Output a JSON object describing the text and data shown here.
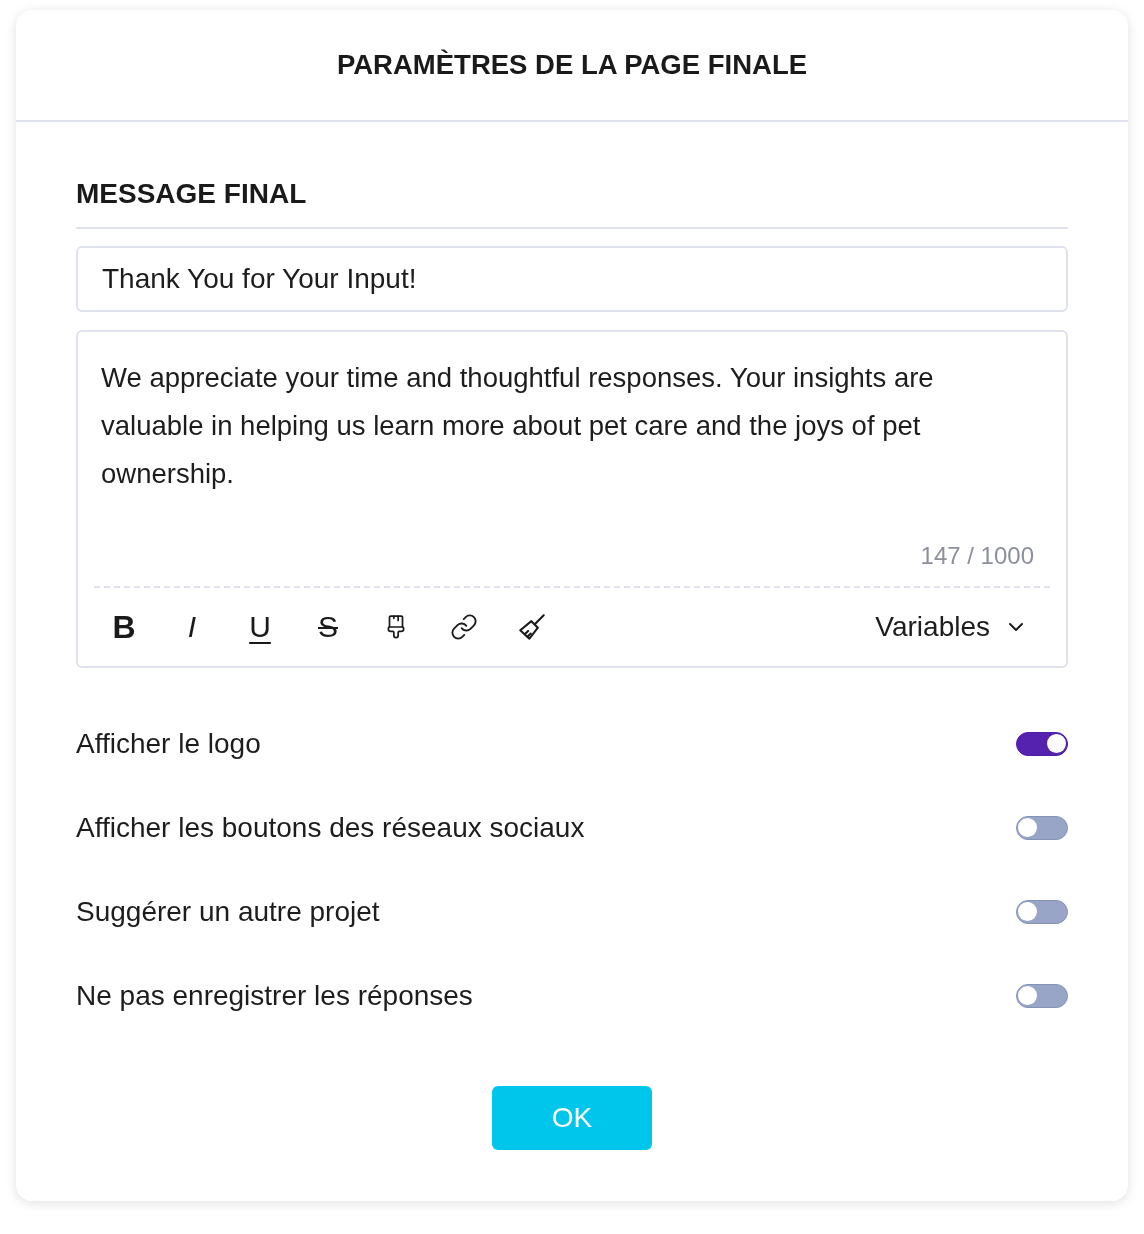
{
  "dialog": {
    "title": "PARAMÈTRES DE LA PAGE FINALE"
  },
  "section": {
    "title": "MESSAGE FINAL"
  },
  "title_field": {
    "value": "Thank You for Your Input!"
  },
  "editor": {
    "value": "We appreciate your time and thoughtful responses. Your insights are valuable in helping us learn more about pet care and the joys of pet ownership.",
    "counter": "147 / 1000",
    "toolbar": [
      {
        "kind": "bold",
        "label": "B"
      },
      {
        "kind": "italic",
        "label": "I"
      },
      {
        "kind": "underline",
        "label": "U"
      },
      {
        "kind": "strike",
        "label": "S"
      },
      {
        "kind": "paint"
      },
      {
        "kind": "link"
      },
      {
        "kind": "clear"
      }
    ],
    "variables": {
      "label": "Variables"
    }
  },
  "options": [
    {
      "label": "Afficher le logo",
      "on": true
    },
    {
      "label": "Afficher les boutons des réseaux sociaux",
      "on": false
    },
    {
      "label": "Suggérer un autre projet",
      "on": false
    },
    {
      "label": "Ne pas enregistrer les réponses",
      "on": false
    }
  ],
  "buttons": [
    {
      "label": "OK"
    }
  ]
}
